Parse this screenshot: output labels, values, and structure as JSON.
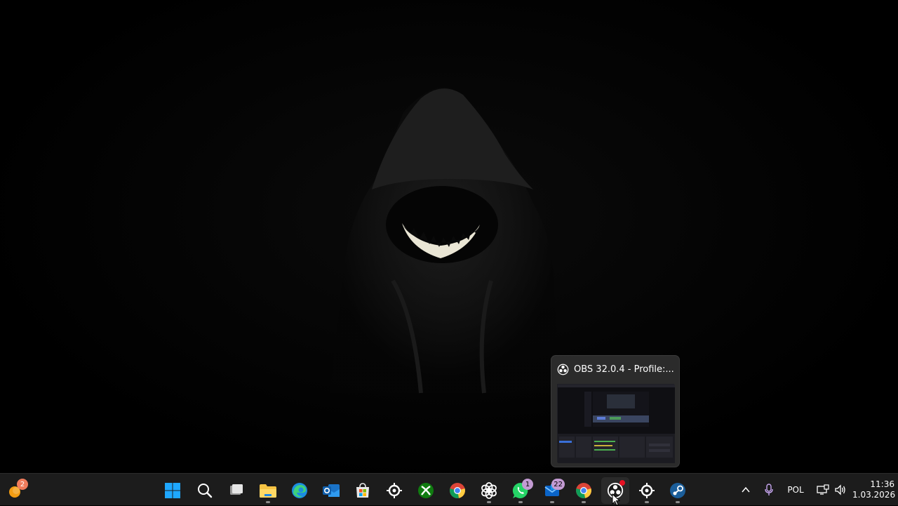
{
  "taskbar": {
    "pinned": [
      {
        "name": "start-button",
        "icon": "windows-logo-icon"
      },
      {
        "name": "search-button",
        "icon": "search-icon"
      },
      {
        "name": "task-view-button",
        "icon": "task-view-icon"
      },
      {
        "name": "file-explorer-button",
        "icon": "folder-icon"
      },
      {
        "name": "edge-button",
        "icon": "edge-icon"
      },
      {
        "name": "outlook-button",
        "icon": "outlook-icon"
      },
      {
        "name": "microsoft-store-button",
        "icon": "store-icon"
      },
      {
        "name": "steelseries-button",
        "icon": "steelseries-icon"
      },
      {
        "name": "xbox-button",
        "icon": "xbox-icon"
      },
      {
        "name": "chrome-button",
        "icon": "chrome-icon"
      },
      {
        "name": "chatgpt-button",
        "icon": "chatgpt-icon"
      },
      {
        "name": "whatsapp-button",
        "icon": "whatsapp-icon",
        "badge": "1"
      },
      {
        "name": "mail-button",
        "icon": "mail-icon",
        "badge": "22"
      },
      {
        "name": "chrome-profile-button",
        "icon": "chrome-icon"
      },
      {
        "name": "obs-button",
        "icon": "obs-icon",
        "recording": true
      },
      {
        "name": "steelseries-gg-button",
        "icon": "steelseries-icon"
      },
      {
        "name": "steam-button",
        "icon": "steam-icon"
      }
    ],
    "widget_badge": "2"
  },
  "tray": {
    "language": "POL",
    "time": "11:36",
    "date": "1.03.2026"
  },
  "preview": {
    "title": "OBS 32.0.4 - Profile:..."
  },
  "colors": {
    "taskbar_bg": "#1c1c1c",
    "accent_blue": "#0078d4",
    "badge_purple": "#c39bd3",
    "record_red": "#e81123"
  }
}
